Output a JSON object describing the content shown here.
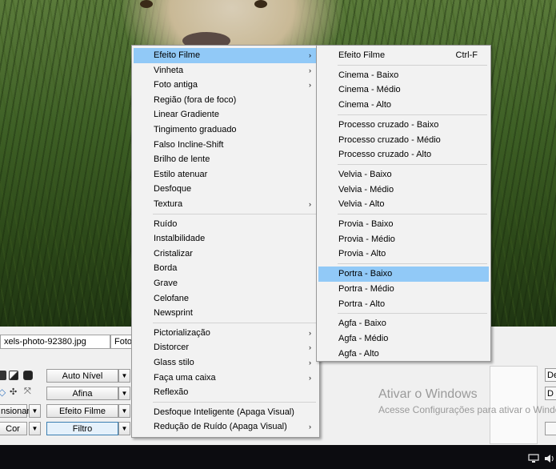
{
  "file_tabs": [
    "xels-photo-92380.jpg",
    "Foto"
  ],
  "controls": {
    "auto_nivel": "Auto Nível",
    "afina": "Afina",
    "efeito_filme": "Efeito Filme",
    "filtro": "Filtro",
    "left_sionar": "nsionar",
    "left_cor": "Cor",
    "dropdown_glyph": "▼"
  },
  "watermark": {
    "title": "Ativar o Windows",
    "subtitle": "Acesse Configurações para ativar o Windows."
  },
  "edge_buttons": [
    "De",
    "D",
    ""
  ],
  "main_menu": {
    "groups": [
      [
        {
          "label": "Efeito Filme",
          "submenu": true,
          "highlighted": true
        },
        {
          "label": "Vinheta",
          "submenu": true
        },
        {
          "label": "Foto antiga",
          "submenu": true
        },
        {
          "label": "Região (fora de foco)"
        },
        {
          "label": "Linear Gradiente"
        },
        {
          "label": "Tingimento graduado"
        },
        {
          "label": "Falso Incline-Shift"
        },
        {
          "label": "Brilho de lente"
        },
        {
          "label": "Estilo atenuar"
        },
        {
          "label": "Desfoque"
        },
        {
          "label": "Textura",
          "submenu": true
        }
      ],
      [
        {
          "label": "Ruído"
        },
        {
          "label": "Instalbilidade"
        },
        {
          "label": "Cristalizar"
        },
        {
          "label": "Borda"
        },
        {
          "label": "Grave"
        },
        {
          "label": "Celofane"
        },
        {
          "label": "Newsprint"
        }
      ],
      [
        {
          "label": "Pictorialização",
          "submenu": true
        },
        {
          "label": "Distorcer",
          "submenu": true
        },
        {
          "label": "Glass stilo",
          "submenu": true
        },
        {
          "label": "Faça uma caixa",
          "submenu": true
        },
        {
          "label": "Reflexão"
        }
      ],
      [
        {
          "label": "Desfoque Inteligente (Apaga Visual)"
        },
        {
          "label": "Redução de Ruído (Apaga Visual)",
          "submenu": true
        }
      ]
    ]
  },
  "sub_menu": {
    "groups": [
      [
        {
          "label": "Efeito Filme",
          "shortcut": "Ctrl-F"
        }
      ],
      [
        {
          "label": "Cinema - Baixo"
        },
        {
          "label": "Cinema - Médio"
        },
        {
          "label": "Cinema - Alto"
        }
      ],
      [
        {
          "label": "Processo cruzado - Baixo"
        },
        {
          "label": "Processo cruzado - Médio"
        },
        {
          "label": "Processo cruzado - Alto"
        }
      ],
      [
        {
          "label": "Velvia - Baixo"
        },
        {
          "label": "Velvia - Médio"
        },
        {
          "label": "Velvia - Alto"
        }
      ],
      [
        {
          "label": "Provia - Baixo"
        },
        {
          "label": "Provia - Médio"
        },
        {
          "label": "Provia - Alto"
        }
      ],
      [
        {
          "label": "Portra - Baixo",
          "highlighted": true
        },
        {
          "label": "Portra - Médio"
        },
        {
          "label": "Portra - Alto"
        }
      ],
      [
        {
          "label": "Agfa - Baixo"
        },
        {
          "label": "Agfa - Médio"
        },
        {
          "label": "Agfa - Alto"
        }
      ]
    ]
  },
  "icons": {
    "submenu_arrow": "›",
    "tray_network": "network-icon",
    "tray_volume": "volume-icon"
  },
  "colors": {
    "highlight": "#91c9f7",
    "menu_bg": "#f2f2f2"
  }
}
